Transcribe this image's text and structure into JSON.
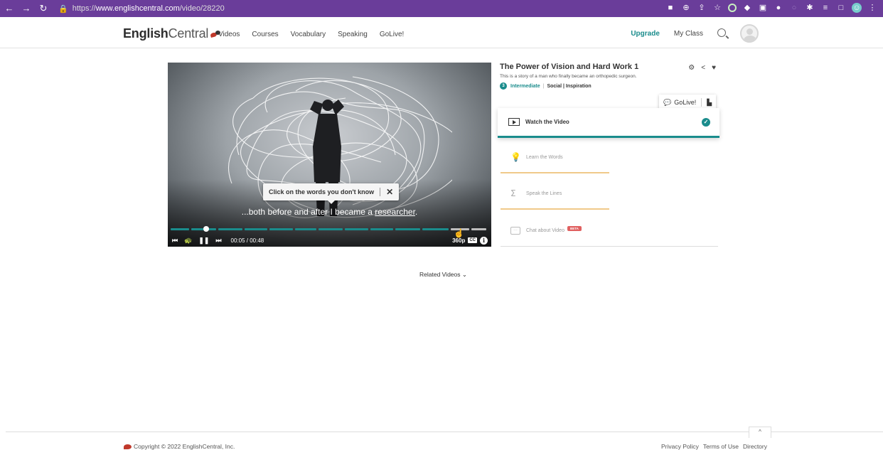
{
  "browser": {
    "url_prefix": "https://",
    "url_host": "www.englishcentral.com",
    "url_path": "/video/28220"
  },
  "header": {
    "logo_bold": "English",
    "logo_light": "Central",
    "nav": [
      "Videos",
      "Courses",
      "Vocabulary",
      "Speaking",
      "GoLive!"
    ],
    "upgrade": "Upgrade",
    "my_class": "My Class"
  },
  "player": {
    "tooltip": "Click on the words you don't know",
    "tooltip_close": "✕",
    "subtitle_before": "...both before and after I became a ",
    "subtitle_word": "researcher",
    "subtitle_after": ".",
    "time": "00:05 / 00:48",
    "quality": "360p",
    "cc": "CC",
    "progress_fraction": 0.104
  },
  "video": {
    "title": "The Power of Vision and Hard Work 1",
    "description": "This is a story of a man who finally became an orthopedic surgeon.",
    "level_num": "3",
    "level": "Intermediate",
    "tags": "Social | Inspiration"
  },
  "golive": {
    "label": "GoLive!"
  },
  "steps": {
    "watch": "Watch the Video",
    "learn": "Learn the Words",
    "speak": "Speak the Lines",
    "chat": "Chat about Video",
    "beta": "BETA"
  },
  "related": "Related Videos",
  "footer": {
    "copyright": "Copyright © 2022 EnglishCentral, Inc.",
    "links": [
      "Privacy Policy",
      "Terms of Use",
      "Directory"
    ]
  },
  "colors": {
    "accent": "#1a8c8c",
    "browser_bar": "#6a3d9a",
    "learn_underline": "#f0c98a"
  }
}
